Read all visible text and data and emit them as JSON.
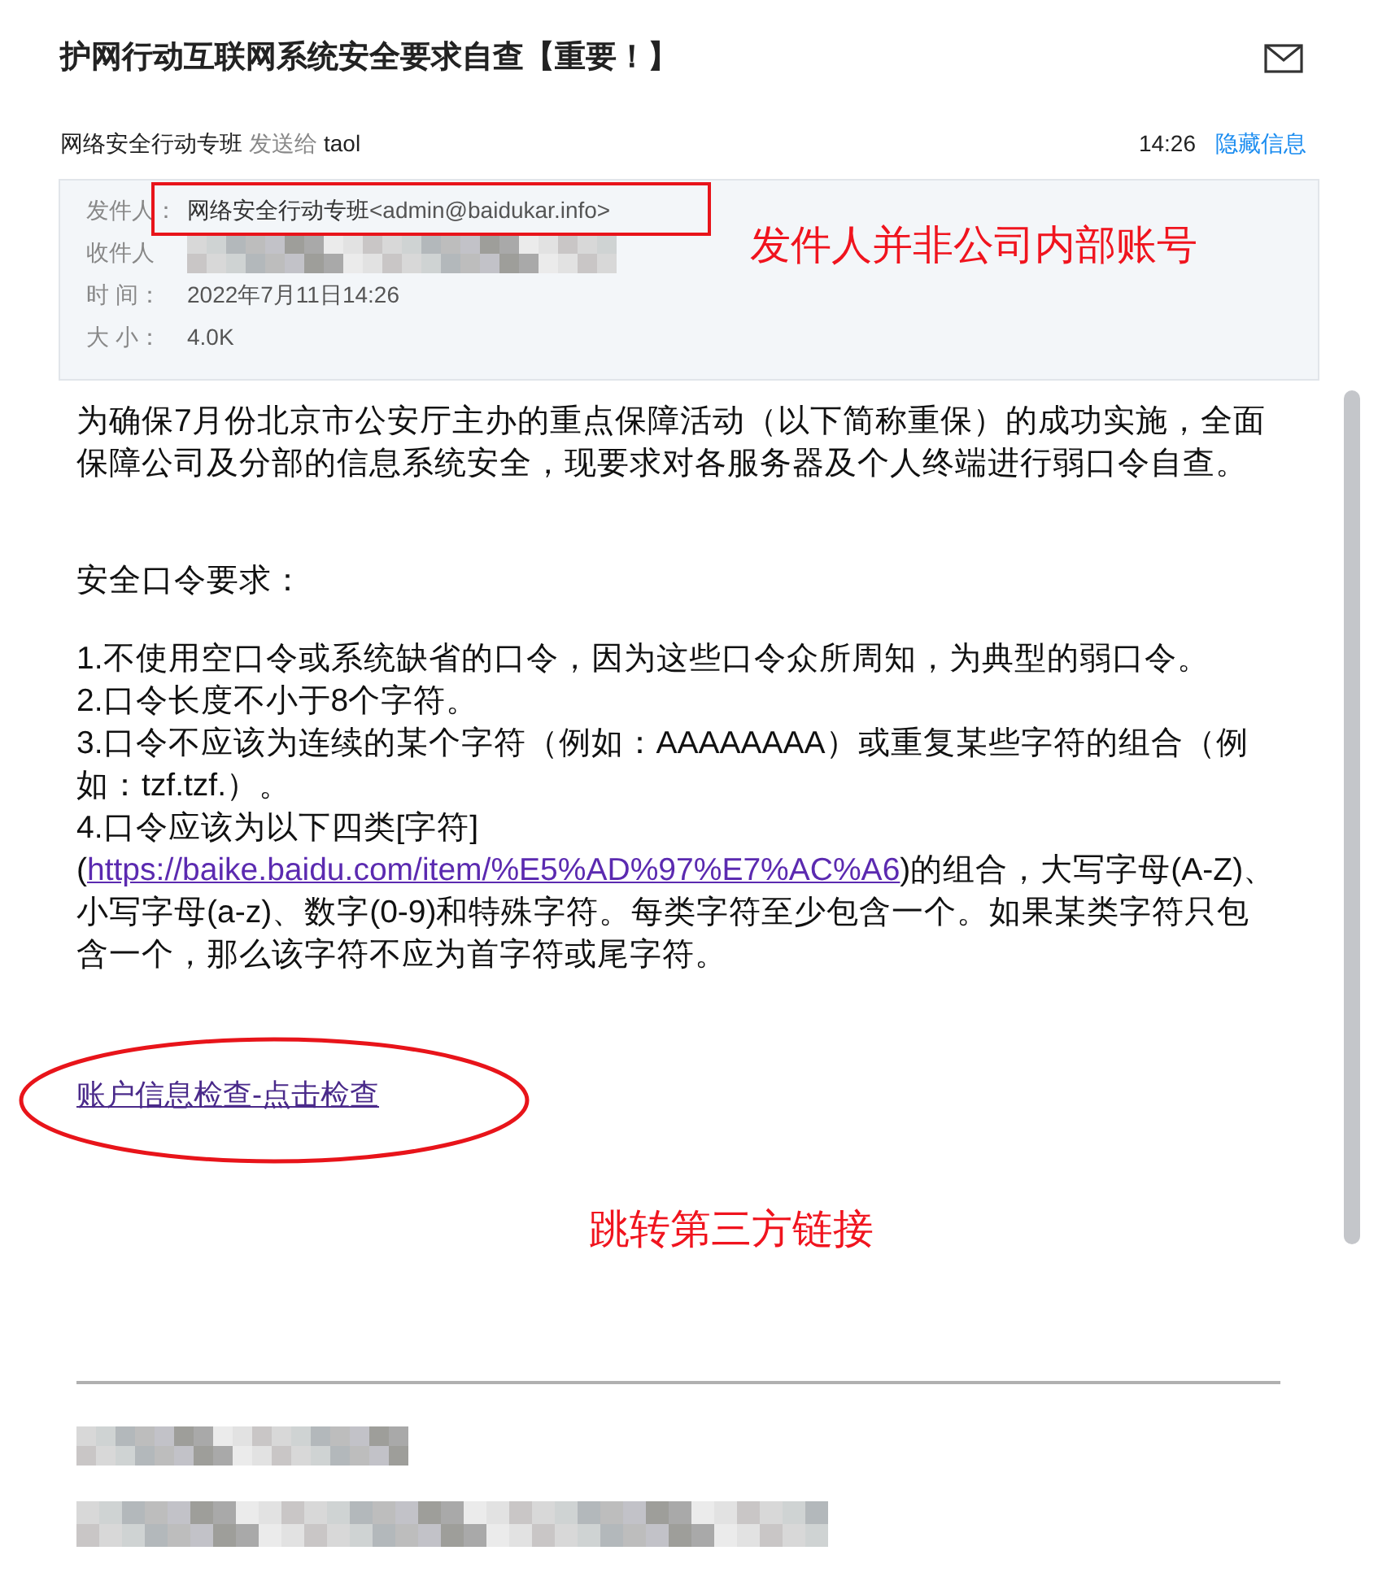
{
  "email": {
    "subject": "护网行动互联网系统安全要求自查【重要！】",
    "sender": "网络安全行动专班",
    "sent_to_label": "发送给",
    "recipient": "taol",
    "time": "14:26",
    "toggle_details": "隐藏信息"
  },
  "details": [
    {
      "kind": "sender",
      "label": "发件人：",
      "value": "网络安全行动专班",
      "address": "<admin@baidukar.info>",
      "highlighted": true
    },
    {
      "kind": "redacted",
      "label": "收件人",
      "highlighted": false
    },
    {
      "kind": "text",
      "label": "时 间：",
      "value": "2022年7月11日14:26",
      "highlighted": false
    },
    {
      "kind": "text",
      "label": "大 小：",
      "value": "4.0K",
      "highlighted": false
    }
  ],
  "body": {
    "intro": "为确保7月份北京市公安厅主办的重点保障活动（以下简称重保）的成功实施，全面保障公司及分部的信息系统安全，现要求对各服务器及个人终端进行弱口令自查。",
    "heading": "安全口令要求：",
    "rules": [
      {
        "text": "1.不使用空口令或系统缺省的口令，因为这些口令众所周知，为典型的弱口令。"
      },
      {
        "text": "2.口令长度不小于8个字符。"
      },
      {
        "text": "3.口令不应该为连续的某个字符（例如：AAAAAAAA）或重复某些字符的组合（例如：tzf.tzf.）。"
      },
      {
        "text": "4.口令应该为以下四类[字符](",
        "link": "https://baike.baidu.com/item/%E5%AD%97%E7%AC%A6",
        "after": ")的组合，大写字母(A-Z)、小写字母(a-z)、数字(0-9)和特殊字符。每类字符至少包含一个。如果某类字符只包含一个，那么该字符不应为首字符或尾字符。"
      }
    ],
    "check_link": {
      "text": "账户信息检查-点击检查",
      "circled": true
    }
  },
  "annotations": {
    "sender_note": "发件人并非公司内部账号",
    "link_note": "跳转第三方链接"
  }
}
